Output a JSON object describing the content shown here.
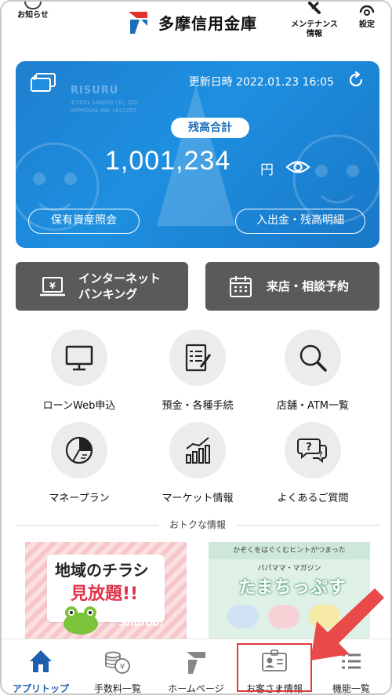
{
  "header": {
    "notifications_label": "お知らせ",
    "bank_name": "多摩信用金庫",
    "maintenance_label_line1": "メンテナンス",
    "maintenance_label_line2": "情報",
    "settings_label": "設定"
  },
  "balance_card": {
    "watermark": "RISURU",
    "copyright_line1": "©2021 SANRIO CO., LTD.",
    "copyright_line2": "APPROVAL NO. L621255",
    "updated_label": "更新日時 2022.01.23 16:05",
    "total_label": "残高合計",
    "amount": "1,001,234",
    "currency": "円",
    "holdings_button": "保有資産照会",
    "statement_button": "入出金・残高明細",
    "card_color": "#1e8fe0"
  },
  "quick_actions": {
    "internet_banking_line1": "インターネット",
    "internet_banking_line2": "バンキング",
    "reservation": "来店・相談予約"
  },
  "menu": {
    "items": [
      {
        "label": "ローンWeb申込",
        "icon": "monitor-icon"
      },
      {
        "label": "預金・各種手続",
        "icon": "document-form-icon"
      },
      {
        "label": "店舗・ATM一覧",
        "icon": "magnifier-icon"
      },
      {
        "label": "マネープラン",
        "icon": "pie-chart-icon"
      },
      {
        "label": "マーケット情報",
        "icon": "bar-line-chart-icon"
      },
      {
        "label": "よくあるご質問",
        "icon": "question-bubble-icon"
      }
    ]
  },
  "deals": {
    "section_label": "おトクな情報",
    "banner1_line1": "地域のチラシ",
    "banner1_line2": "見放題!!",
    "banner1_brand": "Shufoo!",
    "banner2_top": "かぞくをはぐくむヒントがつまった",
    "banner2_sub": "パパママ・マガジン",
    "banner2_title": "たまちっぷす"
  },
  "bottom_nav": {
    "items": [
      {
        "label": "アプリトップ",
        "icon": "home-icon"
      },
      {
        "label": "手数料一覧",
        "icon": "coins-icon"
      },
      {
        "label": "ホームページ",
        "icon": "bank-logo-icon"
      },
      {
        "label": "お客さま情報",
        "icon": "id-card-icon"
      },
      {
        "label": "機能一覧",
        "icon": "list-icon"
      }
    ],
    "active_color": "#1f5fb0",
    "highlight_color": "#e23a3a"
  }
}
